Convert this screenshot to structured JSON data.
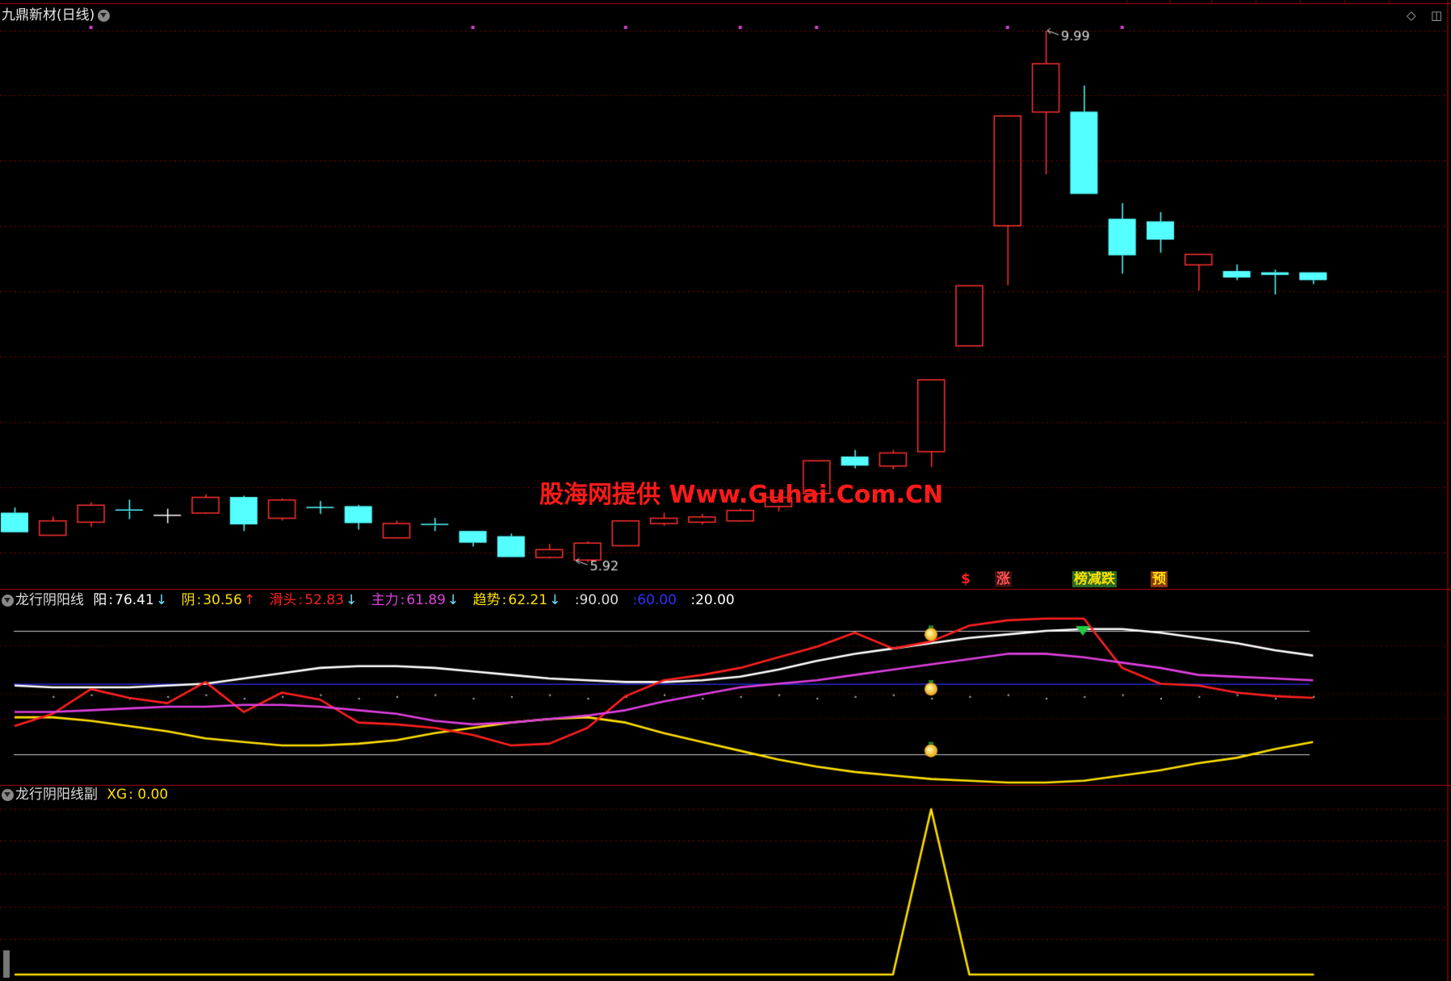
{
  "window": {
    "title": "九鼎新材(日线)",
    "corner_icons": [
      "diamond-icon",
      "panel-icon"
    ]
  },
  "main_panel": {
    "high_label": "9.99",
    "low_label": "5.92",
    "watermark": "股海网提供 Www.Guhai.Com.CN",
    "signals": [
      {
        "text": "$",
        "color": "#ff2020"
      },
      {
        "text": "涨",
        "color": "#ff4040",
        "bg": "#3a1010"
      },
      {
        "text": "榜减跌",
        "color": "#ffe000",
        "bg": "#30702a"
      },
      {
        "text": "预",
        "color": "#ffe000",
        "bg": "#8a3a10"
      }
    ]
  },
  "indicator_panel": {
    "name": "龙行阴阳线",
    "values": [
      {
        "label": "阳",
        "value": "76.41",
        "arrow": "↓",
        "color": "#ffffff",
        "arrow_color": "#6fe0ff"
      },
      {
        "label": "阴",
        "value": "30.56",
        "arrow": "↑",
        "color": "#ffe000",
        "arrow_color": "#ff3030"
      },
      {
        "label": "滑头",
        "value": "52.83",
        "arrow": "↓",
        "color": "#ff2020",
        "arrow_color": "#6fe0ff"
      },
      {
        "label": "主力",
        "value": "61.89",
        "arrow": "↓",
        "color": "#e040e0",
        "arrow_color": "#6fe0ff"
      },
      {
        "label": "趋势",
        "value": "62.21",
        "arrow": "↓",
        "color": "#ffe000",
        "arrow_color": "#6fe0ff"
      },
      {
        "label": "",
        "value": "90.00",
        "arrow": "",
        "color": "#dddddd",
        "arrow_color": "#dddddd"
      },
      {
        "label": "",
        "value": "60.00",
        "arrow": "",
        "color": "#3030ff",
        "arrow_color": "#3030ff"
      },
      {
        "label": "",
        "value": "20.00",
        "arrow": "",
        "color": "#ffffff",
        "arrow_color": "#ffffff"
      }
    ]
  },
  "sub_panel": {
    "name": "龙行阴阳线副",
    "xg_label": "XG",
    "xg_value": "0.00"
  },
  "colors": {
    "up": "#ff3030",
    "down": "#54ffff",
    "grid": "#8b0000",
    "yang": "#ffffff",
    "yin": "#ffe000",
    "hua": "#ff2020",
    "zhuli": "#e040e0",
    "level60": "#3030ff"
  },
  "chart_data": [
    {
      "type": "candlestick",
      "candles": [
        {
          "o": 6.3,
          "h": 6.34,
          "l": 6.15,
          "c": 6.15
        },
        {
          "o": 6.13,
          "h": 6.27,
          "l": 6.12,
          "c": 6.24
        },
        {
          "o": 6.23,
          "h": 6.38,
          "l": 6.19,
          "c": 6.36
        },
        {
          "o": 6.32,
          "h": 6.4,
          "l": 6.25,
          "c": 6.31
        },
        {
          "o": 6.28,
          "h": 6.33,
          "l": 6.22,
          "c": 6.28
        },
        {
          "o": 6.3,
          "h": 6.44,
          "l": 6.29,
          "c": 6.42
        },
        {
          "o": 6.42,
          "h": 6.43,
          "l": 6.16,
          "c": 6.21
        },
        {
          "o": 6.26,
          "h": 6.41,
          "l": 6.24,
          "c": 6.4
        },
        {
          "o": 6.34,
          "h": 6.39,
          "l": 6.29,
          "c": 6.34
        },
        {
          "o": 6.35,
          "h": 6.36,
          "l": 6.17,
          "c": 6.22
        },
        {
          "o": 6.11,
          "h": 6.24,
          "l": 6.11,
          "c": 6.22
        },
        {
          "o": 6.21,
          "h": 6.26,
          "l": 6.16,
          "c": 6.2
        },
        {
          "o": 6.16,
          "h": 6.16,
          "l": 6.04,
          "c": 6.07
        },
        {
          "o": 6.12,
          "h": 6.14,
          "l": 5.96,
          "c": 5.96
        },
        {
          "o": 5.96,
          "h": 6.06,
          "l": 5.95,
          "c": 6.02
        },
        {
          "o": 5.94,
          "h": 6.08,
          "l": 5.92,
          "c": 6.07
        },
        {
          "o": 6.05,
          "h": 6.24,
          "l": 6.05,
          "c": 6.24
        },
        {
          "o": 6.22,
          "h": 6.3,
          "l": 6.2,
          "c": 6.26
        },
        {
          "o": 6.23,
          "h": 6.29,
          "l": 6.21,
          "c": 6.27
        },
        {
          "o": 6.24,
          "h": 6.33,
          "l": 6.23,
          "c": 6.32
        },
        {
          "o": 6.35,
          "h": 6.45,
          "l": 6.31,
          "c": 6.42
        },
        {
          "o": 6.45,
          "h": 6.7,
          "l": 6.43,
          "c": 6.7
        },
        {
          "o": 6.73,
          "h": 6.78,
          "l": 6.64,
          "c": 6.66
        },
        {
          "o": 6.66,
          "h": 6.78,
          "l": 6.63,
          "c": 6.76
        },
        {
          "o": 6.77,
          "h": 7.32,
          "l": 6.65,
          "c": 7.32
        },
        {
          "o": 7.58,
          "h": 8.04,
          "l": 7.58,
          "c": 8.04
        },
        {
          "o": 8.5,
          "h": 9.34,
          "l": 8.04,
          "c": 9.34
        },
        {
          "o": 9.37,
          "h": 9.99,
          "l": 8.89,
          "c": 9.74
        },
        {
          "o": 9.37,
          "h": 9.57,
          "l": 8.74,
          "c": 8.74
        },
        {
          "o": 8.55,
          "h": 8.67,
          "l": 8.13,
          "c": 8.27
        },
        {
          "o": 8.53,
          "h": 8.6,
          "l": 8.29,
          "c": 8.39
        },
        {
          "o": 8.2,
          "h": 8.28,
          "l": 8.0,
          "c": 8.28
        },
        {
          "o": 8.15,
          "h": 8.2,
          "l": 8.08,
          "c": 8.1
        },
        {
          "o": 8.14,
          "h": 8.16,
          "l": 7.97,
          "c": 8.12
        },
        {
          "o": 8.14,
          "h": 8.14,
          "l": 8.05,
          "c": 8.08
        }
      ],
      "high_annotation": {
        "index": 27,
        "value": 9.99
      },
      "low_annotation": {
        "index": 15,
        "value": 5.92
      },
      "pink_markers": [
        2,
        12,
        16,
        19,
        21,
        26,
        29
      ]
    },
    {
      "type": "line",
      "ylim": [
        10,
        100
      ],
      "levels": [
        90,
        60,
        20
      ],
      "series": [
        {
          "name": "阳",
          "values": [
            59,
            58,
            58,
            58,
            59,
            60,
            63,
            66,
            69,
            70,
            70,
            69,
            67,
            65,
            63,
            62,
            61,
            61,
            62,
            64,
            68,
            73,
            77,
            80,
            83,
            86,
            88,
            90,
            91,
            91,
            89,
            86,
            83,
            79,
            76
          ]
        },
        {
          "name": "阴",
          "values": [
            41,
            41,
            39,
            36,
            33,
            29,
            27,
            25,
            25,
            26,
            28,
            32,
            35,
            38,
            40,
            41,
            38,
            32,
            27,
            22,
            17,
            13,
            10,
            8,
            6,
            5,
            4,
            4,
            5,
            8,
            11,
            15,
            18,
            23,
            27
          ]
        },
        {
          "name": "滑头",
          "values": [
            36,
            43,
            57,
            52,
            49,
            61,
            44,
            55,
            51,
            38,
            37,
            35,
            31,
            25,
            26,
            35,
            53,
            62,
            65,
            69,
            75,
            81,
            89,
            80,
            84,
            93,
            96,
            97,
            97,
            69,
            60,
            59,
            55,
            53,
            52
          ]
        },
        {
          "name": "主力",
          "values": [
            44,
            44,
            45,
            46,
            47,
            47,
            48,
            48,
            47,
            45,
            43,
            39,
            37,
            38,
            40,
            42,
            45,
            50,
            54,
            58,
            60,
            62,
            65,
            68,
            71,
            74,
            77,
            77,
            75,
            72,
            69,
            65,
            64,
            63,
            62
          ]
        }
      ],
      "markers": {
        "index": 24,
        "values": [
          88,
          57,
          22
        ]
      },
      "peak_marker": {
        "index": 28,
        "value": 90
      }
    },
    {
      "type": "line",
      "series": [
        {
          "name": "XG",
          "values": [
            0,
            0,
            0,
            0,
            0,
            0,
            0,
            0,
            0,
            0,
            0,
            0,
            0,
            0,
            0,
            0,
            0,
            0,
            0,
            0,
            0,
            0,
            0,
            0,
            1,
            0,
            0,
            0,
            0,
            0,
            0,
            0,
            0,
            0,
            0
          ]
        }
      ],
      "ylim": [
        0,
        1.03
      ]
    }
  ]
}
